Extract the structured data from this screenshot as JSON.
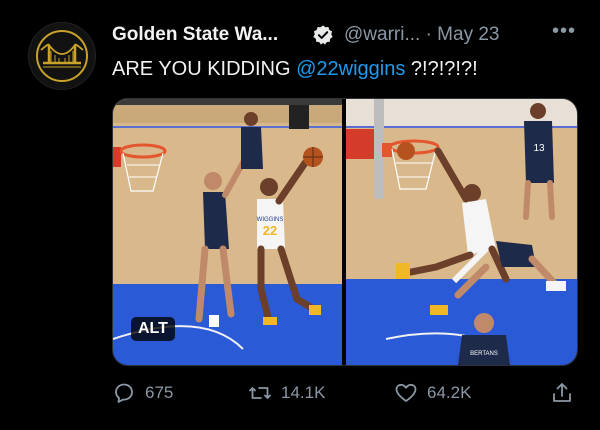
{
  "tweet": {
    "author_name": "Golden State Wa...",
    "handle_date": "@warri... · May 23",
    "text_prefix": "ARE YOU KIDDING ",
    "mention": "@22wiggins",
    "text_suffix": " ?!?!?!?!"
  },
  "media": {
    "alt_label": "ALT",
    "left_jersey_number": "22",
    "left_jersey_name": "WIGGINS",
    "right_jersey_number": "13",
    "right_jersey_name": "BERTANS"
  },
  "actions": {
    "replies": "675",
    "retweets": "14.1K",
    "likes": "64.2K"
  },
  "colors": {
    "background": "#000000",
    "text": "#e7e9ea",
    "muted": "#8b98a5",
    "link": "#1d9bf0",
    "warriors_gold": "#c9a227"
  },
  "icons": [
    "warriors-logo-icon",
    "verified-badge-icon",
    "more-icon",
    "reply-icon",
    "retweet-icon",
    "like-icon",
    "share-icon"
  ]
}
